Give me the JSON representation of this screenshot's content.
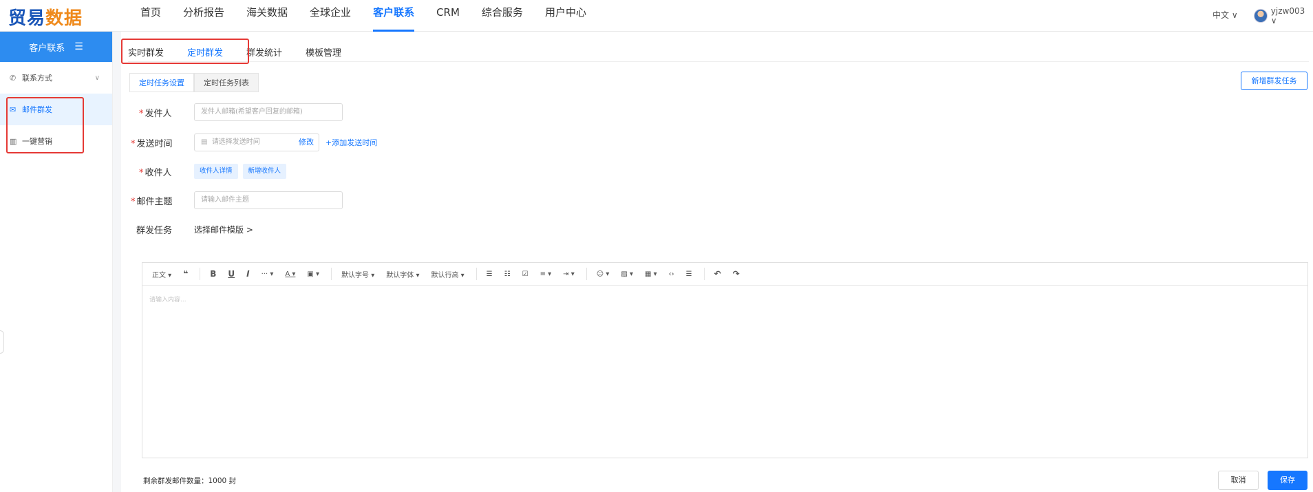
{
  "header": {
    "logo_part1": "贸易",
    "logo_part2": "数据",
    "nav": [
      "首页",
      "分析报告",
      "海关数据",
      "全球企业",
      "客户联系",
      "CRM",
      "综合服务",
      "用户中心"
    ],
    "active_nav": "客户联系",
    "language": "中文 ∨",
    "username": "yjzw003 ∨"
  },
  "sidebar": {
    "title": "客户联系",
    "items": [
      {
        "label": "联系方式",
        "icon": "phone-icon"
      },
      {
        "label": "邮件群发",
        "icon": "mail-icon"
      },
      {
        "label": "一键营销",
        "icon": "bar-chart-icon"
      }
    ]
  },
  "tabs": [
    "实时群发",
    "定时群发",
    "群发统计",
    "模板管理"
  ],
  "subtabs": [
    "定时任务设置",
    "定时任务列表"
  ],
  "new_task_button": "新增群发任务",
  "form": {
    "sender_label": "发件人",
    "sender_placeholder": "发件人邮箱(希望客户回复的邮箱)",
    "time_label": "发送时间",
    "time_placeholder": "请选择发送时间",
    "time_edit": "修改",
    "add_time": "+添加发送时间",
    "recipient_label": "收件人",
    "recipient_detail": "收件人详情",
    "recipient_add": "新增收件人",
    "subject_label": "邮件主题",
    "subject_placeholder": "请输入邮件主题",
    "task_label": "群发任务",
    "template_select": "选择邮件模版 >"
  },
  "editor": {
    "toolbar": {
      "paragraph": "正文 ▾",
      "quote": "❝",
      "bold": "B",
      "underline": "U",
      "italic": "I",
      "more": "··· ▾",
      "font_color": "A ▾",
      "bg_color": "▣ ▾",
      "font_size": "默认字号 ▾",
      "font_family": "默认字体 ▾",
      "line_height": "默认行高 ▾",
      "bullet_list": "☰",
      "number_list": "☷",
      "todo": "☑",
      "align": "≡ ▾",
      "indent": "⇥ ▾",
      "emoji": "☺ ▾",
      "image": "▨ ▾",
      "table": "▦ ▾",
      "code": "‹›",
      "divider": "☰",
      "undo": "↶",
      "redo": "↷"
    },
    "placeholder": "请输入内容..."
  },
  "footer": {
    "remaining": "剩余群发邮件数量：1000 封",
    "cancel": "取消",
    "save": "保存"
  }
}
